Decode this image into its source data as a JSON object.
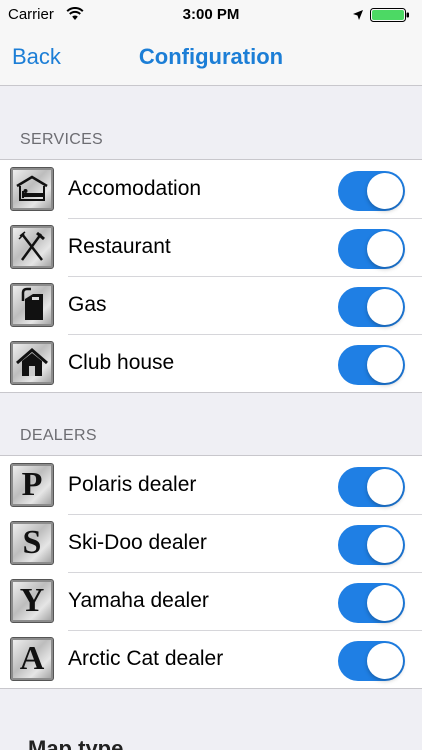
{
  "status_bar": {
    "carrier": "Carrier",
    "time": "3:00 PM",
    "icons": [
      "wifi-icon",
      "location-arrow-icon",
      "battery-icon"
    ]
  },
  "nav": {
    "back_label": "Back",
    "title": "Configuration"
  },
  "services": {
    "header": "SERVICES",
    "items": [
      {
        "label": "Accomodation",
        "icon": "bed-icon",
        "enabled": true
      },
      {
        "label": "Restaurant",
        "icon": "fork-knife-icon",
        "enabled": true
      },
      {
        "label": "Gas",
        "icon": "gas-can-icon",
        "enabled": true
      },
      {
        "label": "Club house",
        "icon": "house-icon",
        "enabled": true
      }
    ]
  },
  "dealers": {
    "header": "DEALERS",
    "items": [
      {
        "label": "Polaris dealer",
        "icon_letter": "P",
        "enabled": true
      },
      {
        "label": "Ski-Doo dealer",
        "icon_letter": "S",
        "enabled": true
      },
      {
        "label": "Yamaha dealer",
        "icon_letter": "Y",
        "enabled": true
      },
      {
        "label": "Arctic Cat dealer",
        "icon_letter": "A",
        "enabled": true
      }
    ]
  },
  "map_type": {
    "header": "Map type"
  },
  "colors": {
    "accent": "#1c7ed6",
    "toggle_on": "#1f7fe4",
    "background": "#efeff4",
    "battery": "#4cd964"
  }
}
